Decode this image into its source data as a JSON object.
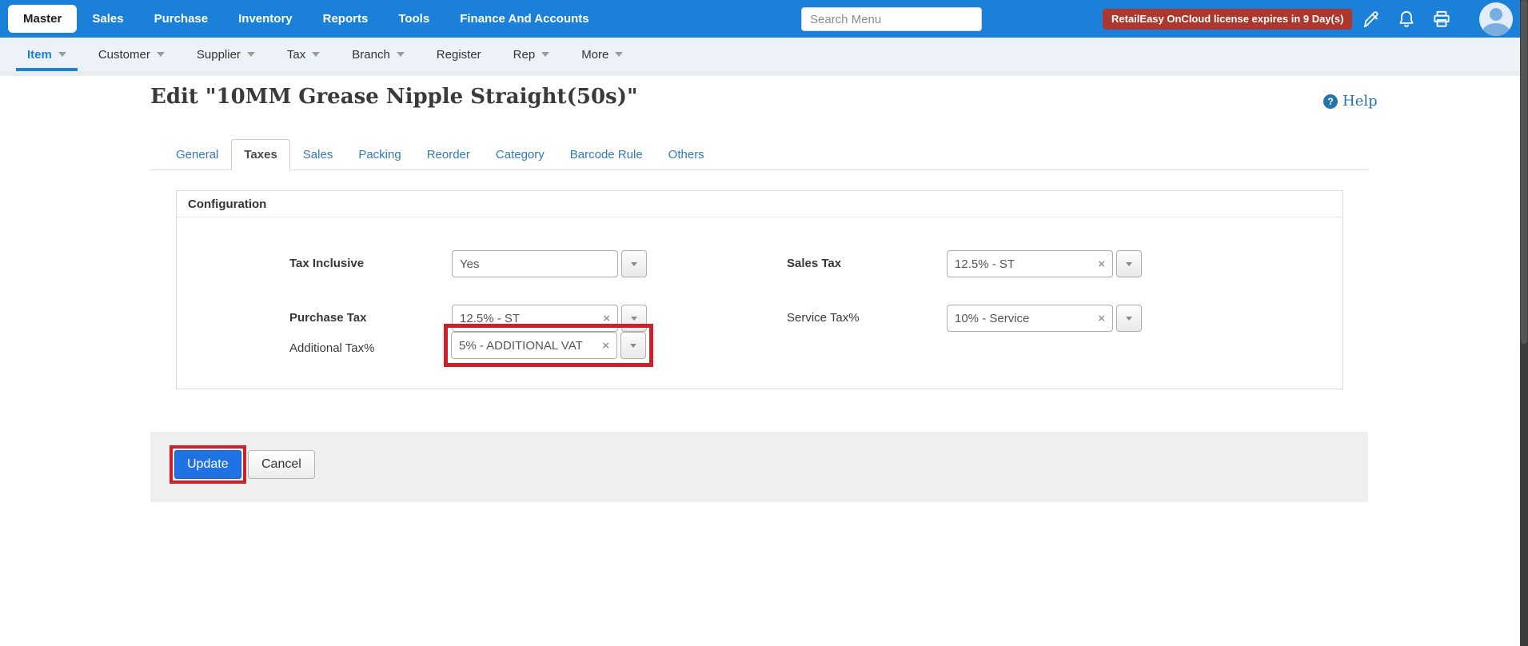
{
  "topbar": {
    "master_label": "Master",
    "menu": [
      "Sales",
      "Purchase",
      "Inventory",
      "Reports",
      "Tools",
      "Finance And Accounts"
    ],
    "search_placeholder": "Search Menu",
    "license_warning": "RetailEasy OnCloud license expires in 9 Day(s)",
    "icons": [
      "brush-icon",
      "notifications-bell-icon",
      "printer-icon",
      "user-avatar"
    ]
  },
  "subnav": {
    "items": [
      {
        "label": "Item",
        "active": true
      },
      {
        "label": "Customer"
      },
      {
        "label": "Supplier"
      },
      {
        "label": "Tax"
      },
      {
        "label": "Branch"
      },
      {
        "label": "Register"
      },
      {
        "label": "Rep"
      },
      {
        "label": "More"
      }
    ]
  },
  "page": {
    "title": "Edit \"10MM Grease Nipple Straight(50s)\"",
    "help_label": "Help"
  },
  "tabs": {
    "labels": [
      "General",
      "Taxes",
      "Sales",
      "Packing",
      "Reorder",
      "Category",
      "Barcode Rule",
      "Others"
    ],
    "active": "Taxes"
  },
  "config": {
    "heading": "Configuration",
    "fields": [
      {
        "label": "Tax Inclusive",
        "value": "Yes",
        "clearable": false,
        "highlighted": false
      },
      {
        "label": "Sales Tax",
        "value": "12.5% - ST",
        "clearable": true,
        "highlighted": false
      },
      {
        "label": "Purchase Tax",
        "value": "12.5% - ST",
        "clearable": true,
        "highlighted": false
      },
      {
        "label": "Service Tax%",
        "value": "10% - Service",
        "clearable": true,
        "highlighted": false
      },
      {
        "label": "Additional Tax%",
        "value": "5% - ADDITIONAL VAT",
        "clearable": true,
        "highlighted": true
      }
    ]
  },
  "footer": {
    "update_label": "Update",
    "cancel_label": "Cancel"
  },
  "glyphs": {
    "clear": "×",
    "help": "?"
  },
  "colors": {
    "topbar_blue": "#1a80d8",
    "subnav_bg": "#ecf2f8",
    "badge_red": "#ae372d",
    "highlight_red": "#ce2029",
    "tab_link_blue": "#337ab7",
    "primary_button_blue": "#2071e3"
  }
}
